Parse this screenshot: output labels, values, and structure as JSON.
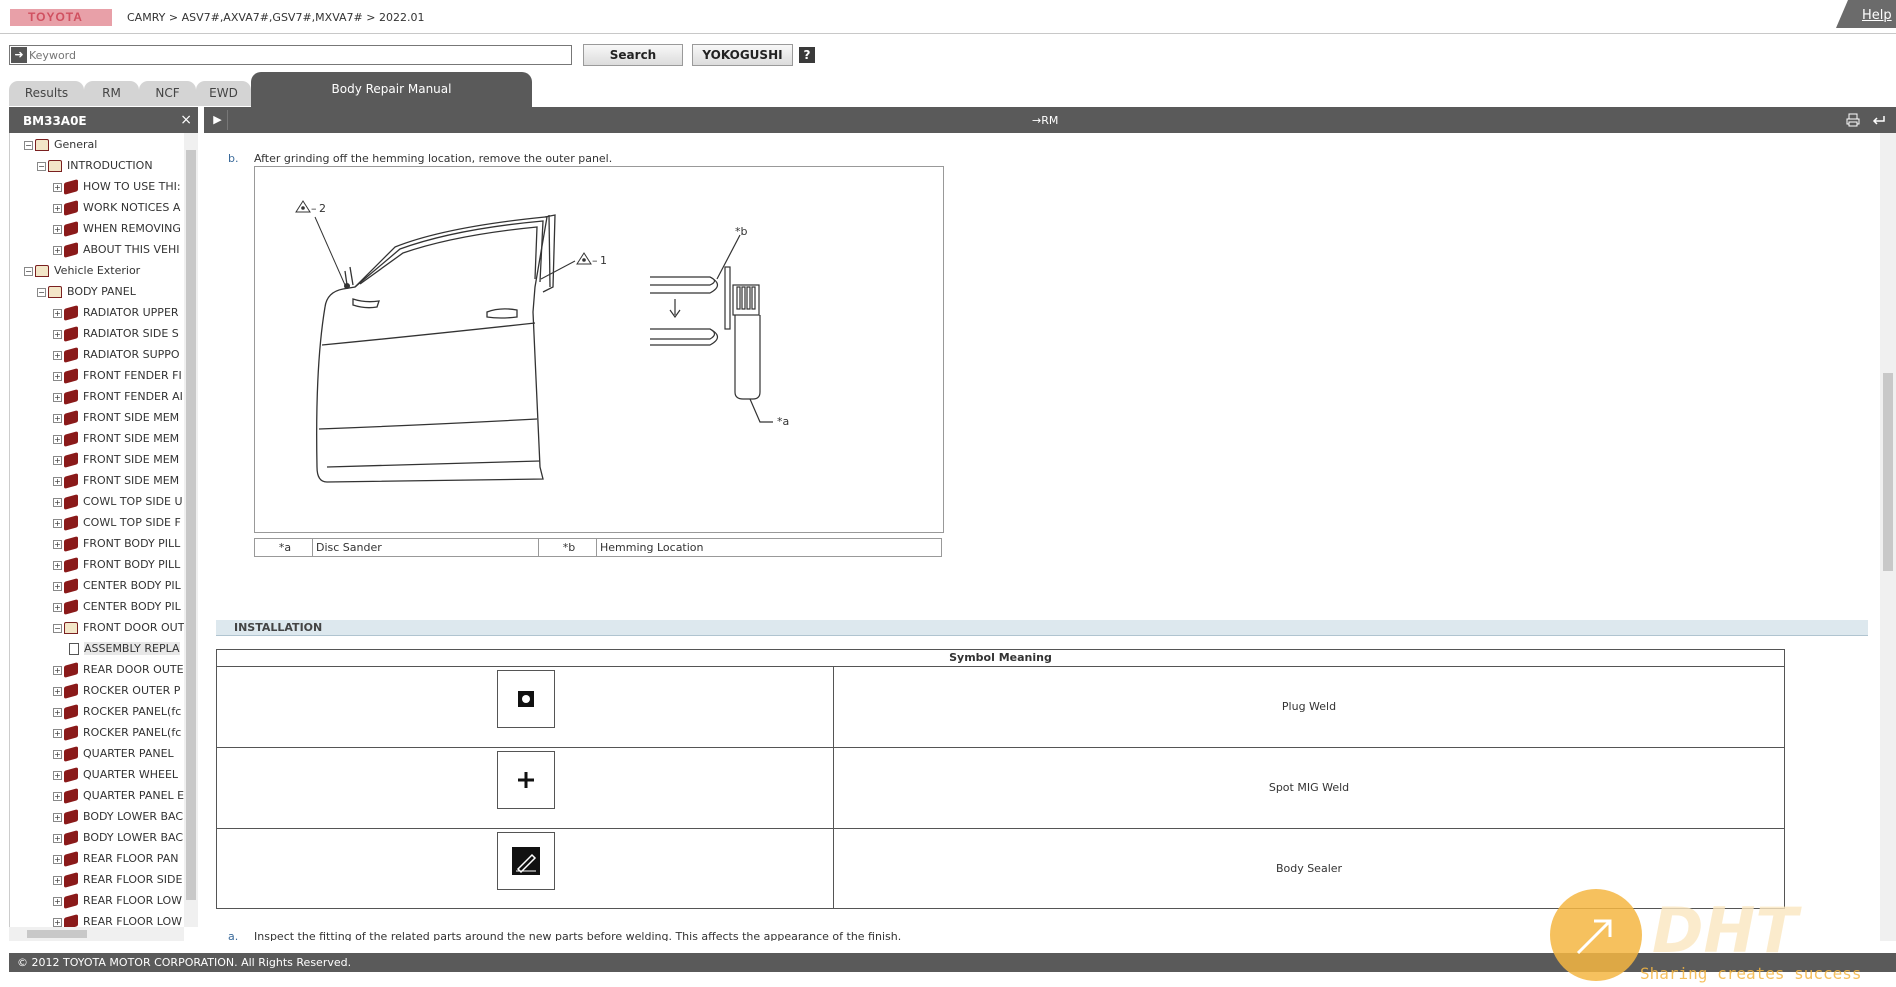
{
  "header": {
    "logo": "TOYOTA",
    "breadcrumb": "CAMRY > ASV7#,AXVA7#,GSV7#,MXVA7# > 2022.01",
    "help": "Help"
  },
  "search": {
    "placeholder": "Keyword",
    "search_label": "Search",
    "yokogushi_label": "YOKOGUSHI",
    "help_label": "?"
  },
  "tabs": [
    {
      "label": "Results"
    },
    {
      "label": "RM"
    },
    {
      "label": "NCF"
    },
    {
      "label": "EWD"
    },
    {
      "label": "Body Repair Manual",
      "active": true
    }
  ],
  "sidebar": {
    "code": "BM33A0E",
    "close": "×",
    "tree": [
      {
        "label": "General",
        "level": 0,
        "toggle": "−",
        "icon": "open-book-icon"
      },
      {
        "label": "INTRODUCTION",
        "level": 1,
        "toggle": "−",
        "icon": "open-book-icon"
      },
      {
        "label": "HOW TO USE THI:",
        "level": 2,
        "toggle": "+",
        "icon": "closed-book-icon"
      },
      {
        "label": "WORK NOTICES A",
        "level": 2,
        "toggle": "+",
        "icon": "closed-book-icon"
      },
      {
        "label": "WHEN REMOVING",
        "level": 2,
        "toggle": "+",
        "icon": "closed-book-icon"
      },
      {
        "label": "ABOUT THIS VEHI",
        "level": 2,
        "toggle": "+",
        "icon": "closed-book-icon"
      },
      {
        "label": "Vehicle Exterior",
        "level": 0,
        "toggle": "−",
        "icon": "open-book-icon"
      },
      {
        "label": "BODY PANEL",
        "level": 1,
        "toggle": "−",
        "icon": "open-book-icon"
      },
      {
        "label": "RADIATOR UPPER",
        "level": 2,
        "toggle": "+",
        "icon": "closed-book-icon"
      },
      {
        "label": "RADIATOR SIDE S",
        "level": 2,
        "toggle": "+",
        "icon": "closed-book-icon"
      },
      {
        "label": "RADIATOR SUPPO",
        "level": 2,
        "toggle": "+",
        "icon": "closed-book-icon"
      },
      {
        "label": "FRONT FENDER FI",
        "level": 2,
        "toggle": "+",
        "icon": "closed-book-icon"
      },
      {
        "label": "FRONT FENDER AI",
        "level": 2,
        "toggle": "+",
        "icon": "closed-book-icon"
      },
      {
        "label": "FRONT SIDE MEM",
        "level": 2,
        "toggle": "+",
        "icon": "closed-book-icon"
      },
      {
        "label": "FRONT SIDE MEM",
        "level": 2,
        "toggle": "+",
        "icon": "closed-book-icon"
      },
      {
        "label": "FRONT SIDE MEM",
        "level": 2,
        "toggle": "+",
        "icon": "closed-book-icon"
      },
      {
        "label": "FRONT SIDE MEM",
        "level": 2,
        "toggle": "+",
        "icon": "closed-book-icon"
      },
      {
        "label": "COWL TOP SIDE U",
        "level": 2,
        "toggle": "+",
        "icon": "closed-book-icon"
      },
      {
        "label": "COWL TOP SIDE F",
        "level": 2,
        "toggle": "+",
        "icon": "closed-book-icon"
      },
      {
        "label": "FRONT BODY PILL",
        "level": 2,
        "toggle": "+",
        "icon": "closed-book-icon"
      },
      {
        "label": "FRONT BODY PILL",
        "level": 2,
        "toggle": "+",
        "icon": "closed-book-icon"
      },
      {
        "label": "CENTER BODY PIL",
        "level": 2,
        "toggle": "+",
        "icon": "closed-book-icon"
      },
      {
        "label": "CENTER BODY PIL",
        "level": 2,
        "toggle": "+",
        "icon": "closed-book-icon"
      },
      {
        "label": "FRONT DOOR OUT",
        "level": 2,
        "toggle": "−",
        "icon": "open-book-icon"
      },
      {
        "label": "ASSEMBLY REPLA",
        "level": 3,
        "toggle": "",
        "icon": "document-icon",
        "selected": true
      },
      {
        "label": "REAR DOOR OUTE",
        "level": 2,
        "toggle": "+",
        "icon": "closed-book-icon"
      },
      {
        "label": "ROCKER OUTER P",
        "level": 2,
        "toggle": "+",
        "icon": "closed-book-icon"
      },
      {
        "label": "ROCKER PANEL(fc",
        "level": 2,
        "toggle": "+",
        "icon": "closed-book-icon"
      },
      {
        "label": "ROCKER PANEL(fc",
        "level": 2,
        "toggle": "+",
        "icon": "closed-book-icon"
      },
      {
        "label": "QUARTER PANEL",
        "level": 2,
        "toggle": "+",
        "icon": "closed-book-icon"
      },
      {
        "label": "QUARTER WHEEL",
        "level": 2,
        "toggle": "+",
        "icon": "closed-book-icon"
      },
      {
        "label": "QUARTER PANEL E",
        "level": 2,
        "toggle": "+",
        "icon": "closed-book-icon"
      },
      {
        "label": "BODY LOWER BAC",
        "level": 2,
        "toggle": "+",
        "icon": "closed-book-icon"
      },
      {
        "label": "BODY LOWER BAC",
        "level": 2,
        "toggle": "+",
        "icon": "closed-book-icon"
      },
      {
        "label": "REAR FLOOR PAN",
        "level": 2,
        "toggle": "+",
        "icon": "closed-book-icon"
      },
      {
        "label": "REAR FLOOR SIDE",
        "level": 2,
        "toggle": "+",
        "icon": "closed-book-icon"
      },
      {
        "label": "REAR FLOOR LOW",
        "level": 2,
        "toggle": "+",
        "icon": "closed-book-icon"
      },
      {
        "label": "REAR FLOOR LOW",
        "level": 2,
        "toggle": "+",
        "icon": "closed-book-icon"
      }
    ]
  },
  "toolbar": {
    "rm_link": "→RM",
    "play_icon": "play-icon",
    "print_icon": "print-icon",
    "back_icon": "back-icon"
  },
  "content": {
    "step_b": {
      "label": "b.",
      "text": "After grinding off the hemming location, remove the outer panel."
    },
    "figure": {
      "callout_1": "1",
      "callout_2": "2",
      "callout_a": "*a",
      "callout_b": "*b"
    },
    "legend": [
      {
        "key": "*a",
        "value": "Disc Sander"
      },
      {
        "key": "*b",
        "value": "Hemming Location"
      }
    ],
    "installation_heading": "INSTALLATION",
    "symbol_table": {
      "header": "Symbol Meaning",
      "rows": [
        {
          "icon": "plug-weld-icon",
          "meaning": "Plug Weld"
        },
        {
          "icon": "spot-mig-weld-icon",
          "meaning": "Spot MIG Weld"
        },
        {
          "icon": "body-sealer-icon",
          "meaning": "Body Sealer"
        }
      ]
    },
    "step_a": {
      "label": "a.",
      "text": "Inspect the fitting of the related parts around the new parts before welding. This affects the appearance of the finish."
    }
  },
  "footer": {
    "copyright": "© 2012 TOYOTA MOTOR CORPORATION. All Rights Reserved."
  },
  "watermark": {
    "brand": "DHT",
    "tagline": "Sharing creates success"
  },
  "colors": {
    "header_bar": "#5a5a5a",
    "tab_inactive": "#d4d4d4",
    "book_icon": "#8a1a1a",
    "installation_bar": "#dde8ee",
    "watermark_orange": "#f5b642"
  }
}
